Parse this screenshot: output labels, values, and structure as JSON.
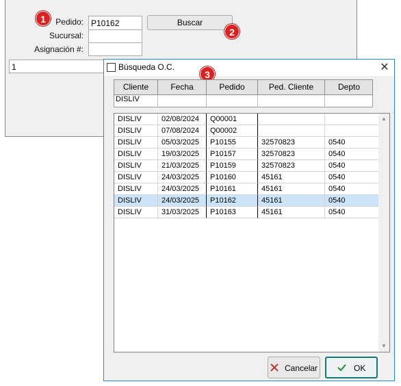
{
  "form": {
    "pedido_label": "Pedido:",
    "pedido_value": "P10162",
    "sucursal_label": "Sucursal:",
    "sucursal_value": "",
    "asignacion_label": "Asignación #:",
    "asignacion_value": "",
    "buscar_label": "Buscar",
    "extra_value": "1"
  },
  "badges": [
    "1",
    "2",
    "3"
  ],
  "dialog": {
    "title": "Búsqueda O.C.",
    "close_glyph": "✕",
    "columns": [
      "Cliente",
      "Fecha",
      "Pedido",
      "Ped. Cliente",
      "Depto"
    ],
    "filter": {
      "cliente": "DISLIV",
      "fecha": "",
      "pedido": "",
      "ped_cliente": "",
      "depto": ""
    },
    "rows": [
      [
        "DISLIV",
        "02/08/2024",
        "Q00001",
        "",
        ""
      ],
      [
        "DISLIV",
        "07/08/2024",
        "Q00002",
        "",
        ""
      ],
      [
        "DISLIV",
        "05/03/2025",
        "P10155",
        "32570823",
        "0540"
      ],
      [
        "DISLIV",
        "19/03/2025",
        "P10157",
        "32570823",
        "0540"
      ],
      [
        "DISLIV",
        "21/03/2025",
        "P10159",
        "32570823",
        "0540"
      ],
      [
        "DISLIV",
        "24/03/2025",
        "P10160",
        "45161",
        "0540"
      ],
      [
        "DISLIV",
        "24/03/2025",
        "P10161",
        "45161",
        "0540"
      ],
      [
        "DISLIV",
        "24/03/2025",
        "P10162",
        "45161",
        "0540"
      ],
      [
        "DISLIV",
        "31/03/2025",
        "P10163",
        "45161",
        "0540"
      ]
    ],
    "selected_row": 7,
    "cancel_label": "Cancelar",
    "ok_label": "OK",
    "cancel_icon": "close-x-icon",
    "ok_icon": "check-icon"
  },
  "colors": {
    "badge": "#e02020",
    "selection": "#cce4f7",
    "dialog_border": "#1f8ad3",
    "ok_border": "#0f7a73",
    "cancel_icon": "#c0392b",
    "ok_icon": "#1e8a3c"
  }
}
